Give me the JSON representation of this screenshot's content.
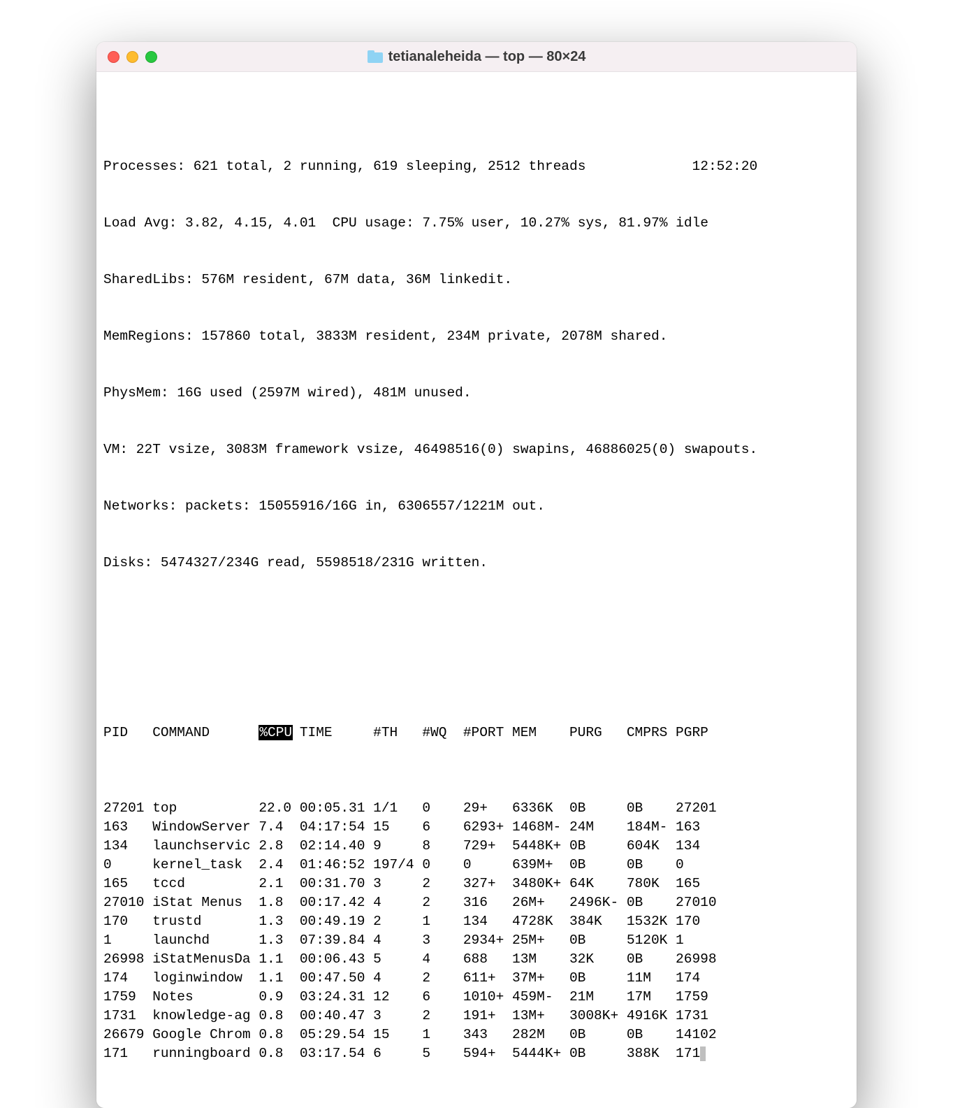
{
  "window": {
    "title": "tetianaleheida — top — 80×24"
  },
  "header": {
    "processes": "Processes: 621 total, 2 running, 619 sleeping, 2512 threads",
    "clock": "12:52:20",
    "load": "Load Avg: 3.82, 4.15, 4.01  CPU usage: 7.75% user, 10.27% sys, 81.97% idle",
    "sharedlibs": "SharedLibs: 576M resident, 67M data, 36M linkedit.",
    "memregions": "MemRegions: 157860 total, 3833M resident, 234M private, 2078M shared.",
    "physmem": "PhysMem: 16G used (2597M wired), 481M unused.",
    "vm": "VM: 22T vsize, 3083M framework vsize, 46498516(0) swapins, 46886025(0) swapouts.",
    "networks": "Networks: packets: 15055916/16G in, 6306557/1221M out.",
    "disks": "Disks: 5474327/234G read, 5598518/231G written."
  },
  "columns": {
    "pid": "PID",
    "command": "COMMAND",
    "cpu": "%CPU",
    "time": "TIME",
    "th": "#TH",
    "wq": "#WQ",
    "port": "#PORT",
    "mem": "MEM",
    "purg": "PURG",
    "cmprs": "CMPRS",
    "pgrp": "PGRP"
  },
  "rows": [
    {
      "pid": "27201",
      "cmd": "top",
      "cpu": "22.0",
      "time": "00:05.31",
      "th": "1/1",
      "wq": "0",
      "port": "29+",
      "mem": "6336K",
      "purg": "0B",
      "cmprs": "0B",
      "pgrp": "27201"
    },
    {
      "pid": "163",
      "cmd": "WindowServer",
      "cpu": "7.4",
      "time": "04:17:54",
      "th": "15",
      "wq": "6",
      "port": "6293+",
      "mem": "1468M-",
      "purg": "24M",
      "cmprs": "184M-",
      "pgrp": "163"
    },
    {
      "pid": "134",
      "cmd": "launchservic",
      "cpu": "2.8",
      "time": "02:14.40",
      "th": "9",
      "wq": "8",
      "port": "729+",
      "mem": "5448K+",
      "purg": "0B",
      "cmprs": "604K",
      "pgrp": "134"
    },
    {
      "pid": "0",
      "cmd": "kernel_task",
      "cpu": "2.4",
      "time": "01:46:52",
      "th": "197/4",
      "wq": "0",
      "port": "0",
      "mem": "639M+",
      "purg": "0B",
      "cmprs": "0B",
      "pgrp": "0"
    },
    {
      "pid": "165",
      "cmd": "tccd",
      "cpu": "2.1",
      "time": "00:31.70",
      "th": "3",
      "wq": "2",
      "port": "327+",
      "mem": "3480K+",
      "purg": "64K",
      "cmprs": "780K",
      "pgrp": "165"
    },
    {
      "pid": "27010",
      "cmd": "iStat Menus",
      "cpu": "1.8",
      "time": "00:17.42",
      "th": "4",
      "wq": "2",
      "port": "316",
      "mem": "26M+",
      "purg": "2496K-",
      "cmprs": "0B",
      "pgrp": "27010"
    },
    {
      "pid": "170",
      "cmd": "trustd",
      "cpu": "1.3",
      "time": "00:49.19",
      "th": "2",
      "wq": "1",
      "port": "134",
      "mem": "4728K",
      "purg": "384K",
      "cmprs": "1532K",
      "pgrp": "170"
    },
    {
      "pid": "1",
      "cmd": "launchd",
      "cpu": "1.3",
      "time": "07:39.84",
      "th": "4",
      "wq": "3",
      "port": "2934+",
      "mem": "25M+",
      "purg": "0B",
      "cmprs": "5120K",
      "pgrp": "1"
    },
    {
      "pid": "26998",
      "cmd": "iStatMenusDa",
      "cpu": "1.1",
      "time": "00:06.43",
      "th": "5",
      "wq": "4",
      "port": "688",
      "mem": "13M",
      "purg": "32K",
      "cmprs": "0B",
      "pgrp": "26998"
    },
    {
      "pid": "174",
      "cmd": "loginwindow",
      "cpu": "1.1",
      "time": "00:47.50",
      "th": "4",
      "wq": "2",
      "port": "611+",
      "mem": "37M+",
      "purg": "0B",
      "cmprs": "11M",
      "pgrp": "174"
    },
    {
      "pid": "1759",
      "cmd": "Notes",
      "cpu": "0.9",
      "time": "03:24.31",
      "th": "12",
      "wq": "6",
      "port": "1010+",
      "mem": "459M-",
      "purg": "21M",
      "cmprs": "17M",
      "pgrp": "1759"
    },
    {
      "pid": "1731",
      "cmd": "knowledge-ag",
      "cpu": "0.8",
      "time": "00:40.47",
      "th": "3",
      "wq": "2",
      "port": "191+",
      "mem": "13M+",
      "purg": "3008K+",
      "cmprs": "4916K",
      "pgrp": "1731"
    },
    {
      "pid": "26679",
      "cmd": "Google Chrom",
      "cpu": "0.8",
      "time": "05:29.54",
      "th": "15",
      "wq": "1",
      "port": "343",
      "mem": "282M",
      "purg": "0B",
      "cmprs": "0B",
      "pgrp": "14102"
    },
    {
      "pid": "171",
      "cmd": "runningboard",
      "cpu": "0.8",
      "time": "03:17.54",
      "th": "6",
      "wq": "5",
      "port": "594+",
      "mem": "5444K+",
      "purg": "0B",
      "cmprs": "388K",
      "pgrp": "171"
    }
  ]
}
